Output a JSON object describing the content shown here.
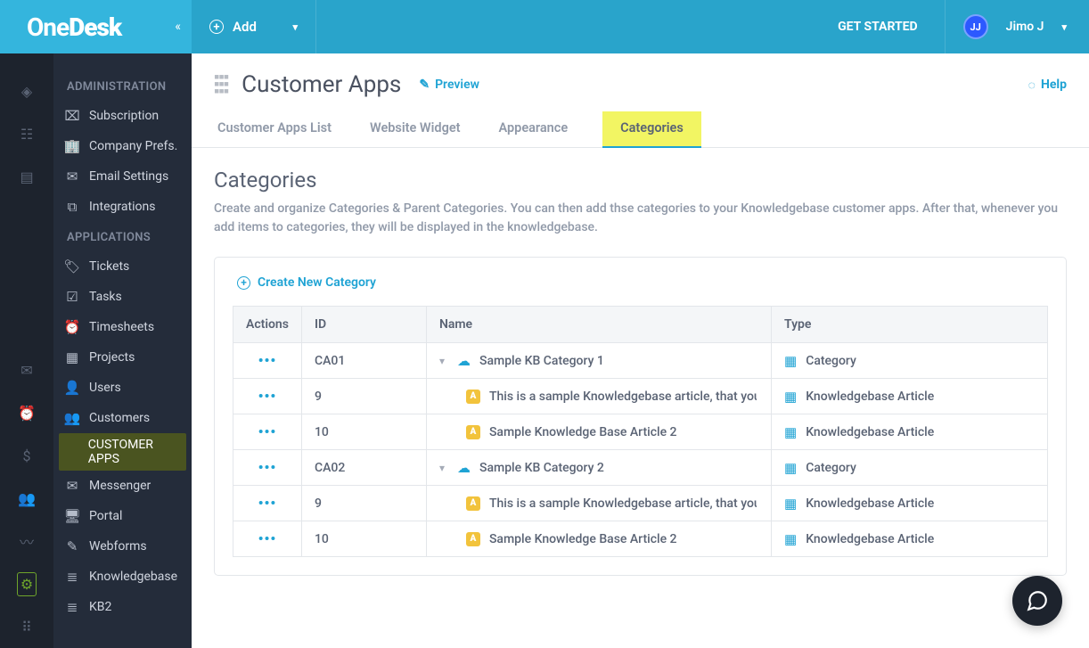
{
  "header": {
    "logo_prefix": "One",
    "logo_suffix": "Desk",
    "add_label": "Add",
    "get_started": "GET STARTED",
    "avatar_initials": "JJ",
    "user_name": "Jimo J"
  },
  "sidebar": {
    "section_admin": "ADMINISTRATION",
    "admin_items": [
      {
        "label": "Subscription"
      },
      {
        "label": "Company Prefs."
      },
      {
        "label": "Email Settings"
      },
      {
        "label": "Integrations"
      }
    ],
    "section_apps": "APPLICATIONS",
    "app_items": [
      {
        "label": "Tickets"
      },
      {
        "label": "Tasks"
      },
      {
        "label": "Timesheets"
      },
      {
        "label": "Projects"
      },
      {
        "label": "Users"
      },
      {
        "label": "Customers"
      },
      {
        "label": "CUSTOMER APPS",
        "active": true
      },
      {
        "label": "Messenger"
      },
      {
        "label": "Portal"
      },
      {
        "label": "Webforms"
      },
      {
        "label": "Knowledgebase"
      },
      {
        "label": "KB2"
      }
    ]
  },
  "page": {
    "title": "Customer Apps",
    "preview": "Preview",
    "help": "Help"
  },
  "tabs": [
    {
      "label": "Customer Apps List"
    },
    {
      "label": "Website Widget"
    },
    {
      "label": "Appearance"
    },
    {
      "label": "Categories",
      "active": true
    }
  ],
  "section": {
    "title": "Categories",
    "desc": "Create and organize Categories & Parent Categories. You can then add thse categories to your Knowledgebase customer apps. After that, whenever you add items to categories, they will be displayed in the knowledgebase."
  },
  "table": {
    "create_label": "Create New Category",
    "headers": {
      "actions": "Actions",
      "id": "ID",
      "name": "Name",
      "type": "Type"
    },
    "rows": [
      {
        "id": "CA01",
        "name": "Sample KB Category 1",
        "type": "Category",
        "is_cat": true
      },
      {
        "id": "9",
        "name": "This is a sample Knowledgebase article, that you can ret",
        "type": "Knowledgebase Article",
        "is_cat": false
      },
      {
        "id": "10",
        "name": "Sample Knowledge Base Article 2",
        "type": "Knowledgebase Article",
        "is_cat": false
      },
      {
        "id": "CA02",
        "name": "Sample KB Category 2",
        "type": "Category",
        "is_cat": true
      },
      {
        "id": "9",
        "name": "This is a sample Knowledgebase article, that you can ret",
        "type": "Knowledgebase Article",
        "is_cat": false
      },
      {
        "id": "10",
        "name": "Sample Knowledge Base Article 2",
        "type": "Knowledgebase Article",
        "is_cat": false
      }
    ]
  }
}
